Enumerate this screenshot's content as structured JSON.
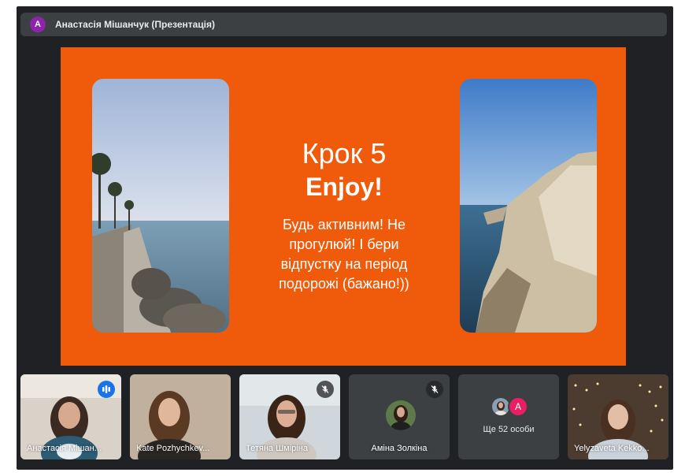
{
  "header": {
    "avatar_letter": "А",
    "presenter_title": "Анастасія Мішанчук (Презентація)"
  },
  "slide": {
    "step": "Крок 5",
    "headline": "Enjoy!",
    "body": "Будь активним! Не прогулюй! І бери відпустку на період подорожі (бажано!))"
  },
  "participants": [
    {
      "name": "Анастасія Мішан...",
      "state": "speaking"
    },
    {
      "name": "Kate Pozhychkev...",
      "state": "normal"
    },
    {
      "name": "Тетяна Шміріна",
      "state": "muted"
    },
    {
      "name": "Аміна Золкіна",
      "state": "muted"
    },
    {
      "more_label": "Ще 52 особи",
      "avatar_letter": "A"
    },
    {
      "name": "Yelyzaveta Kekko...",
      "state": "normal"
    }
  ],
  "colors": {
    "slide_background": "#f05a0b",
    "app_background": "#202124",
    "active_outline": "#8ab4f8",
    "speaking_badge": "#1a73e8"
  },
  "icons": {
    "speaking": "audio-bars-icon",
    "muted": "mic-off-icon"
  }
}
